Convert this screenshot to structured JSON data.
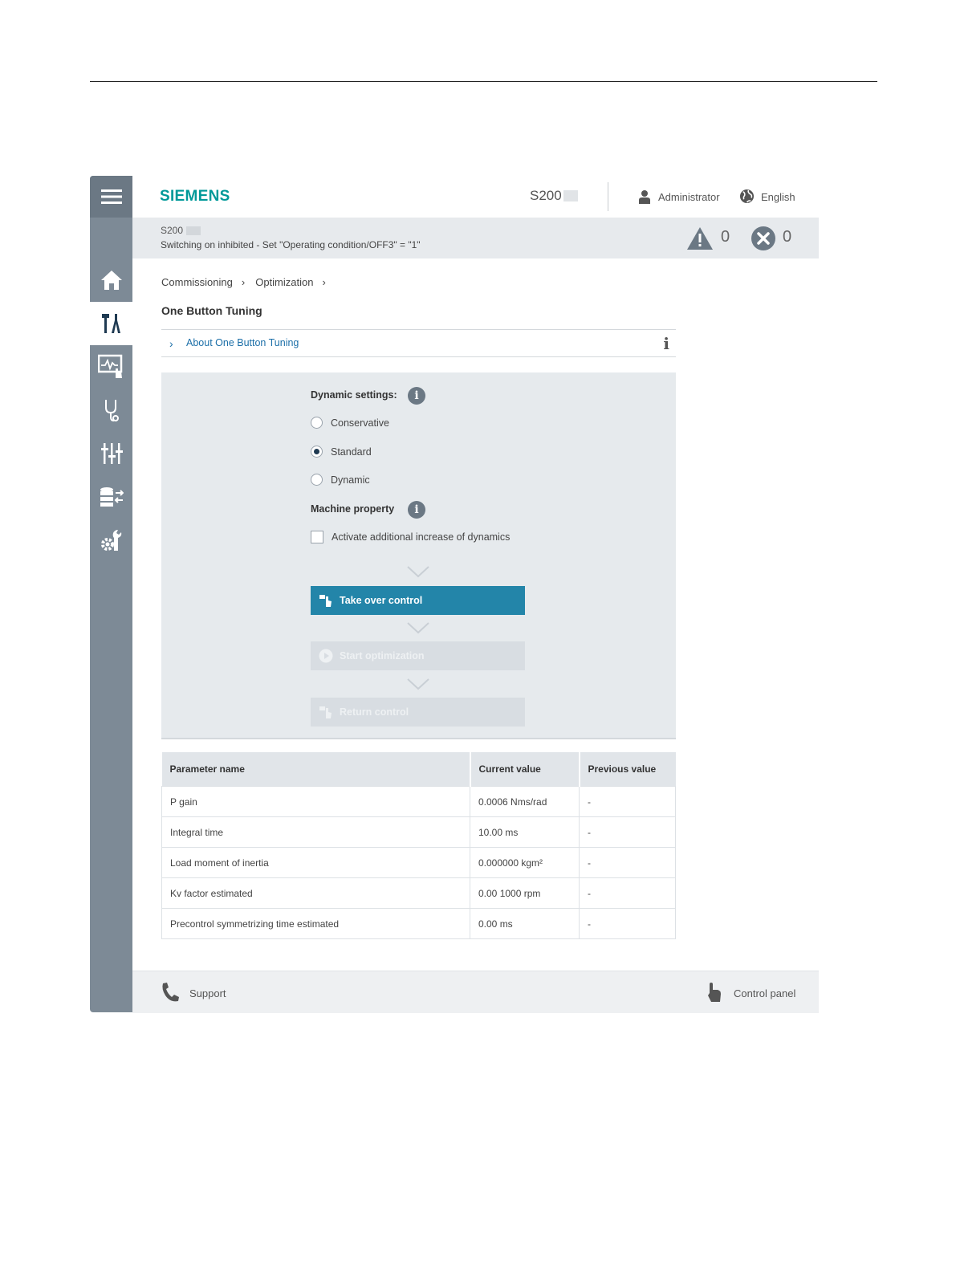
{
  "header": {
    "logo": "SIEMENS",
    "device": "S200",
    "user": "Administrator",
    "language": "English"
  },
  "status": {
    "device": "S200",
    "message": "Switching on inhibited - Set \"Operating condition/OFF3\" = \"1\"",
    "warnings": "0",
    "errors": "0"
  },
  "sidebar": {
    "items": [
      {
        "name": "home",
        "icon": "home-icon"
      },
      {
        "name": "commissioning",
        "icon": "tools-icon",
        "active": true
      },
      {
        "name": "monitoring",
        "icon": "monitor-touch-icon"
      },
      {
        "name": "diagnostics",
        "icon": "stethoscope-icon"
      },
      {
        "name": "parameters",
        "icon": "sliders-icon"
      },
      {
        "name": "backup-restore",
        "icon": "database-transfer-icon"
      },
      {
        "name": "system",
        "icon": "gear-wrench-icon"
      }
    ]
  },
  "breadcrumb": [
    "Commissioning",
    "Optimization"
  ],
  "page_title": "One Button Tuning",
  "about": {
    "label": "About One Button Tuning",
    "info": "i"
  },
  "tuning": {
    "dynamic_label": "Dynamic settings:",
    "options": [
      "Conservative",
      "Standard",
      "Dynamic"
    ],
    "selected": "Standard",
    "machine_label": "Machine property",
    "checkbox_label": "Activate additional increase of dynamics",
    "checkbox_checked": false,
    "steps": {
      "take_over": "Take over control",
      "start": "Start optimization",
      "return": "Return control"
    }
  },
  "table": {
    "headers": [
      "Parameter name",
      "Current value",
      "Previous value"
    ],
    "rows": [
      [
        "P gain",
        "0.0006 Nms/rad",
        "-"
      ],
      [
        "Integral time",
        "10.00 ms",
        "-"
      ],
      [
        "Load moment of inertia",
        "0.000000 kgm²",
        "-"
      ],
      [
        "Kv factor estimated",
        "0.00 1000 rpm",
        "-"
      ],
      [
        "Precontrol symmetrizing time estimated",
        "0.00 ms",
        "-"
      ]
    ]
  },
  "footer": {
    "support": "Support",
    "control_panel": "Control panel"
  },
  "colors": {
    "brand": "#009999",
    "primary_button": "#2385a9",
    "sidebar": "#7d8a96",
    "link": "#1c6fa8"
  }
}
